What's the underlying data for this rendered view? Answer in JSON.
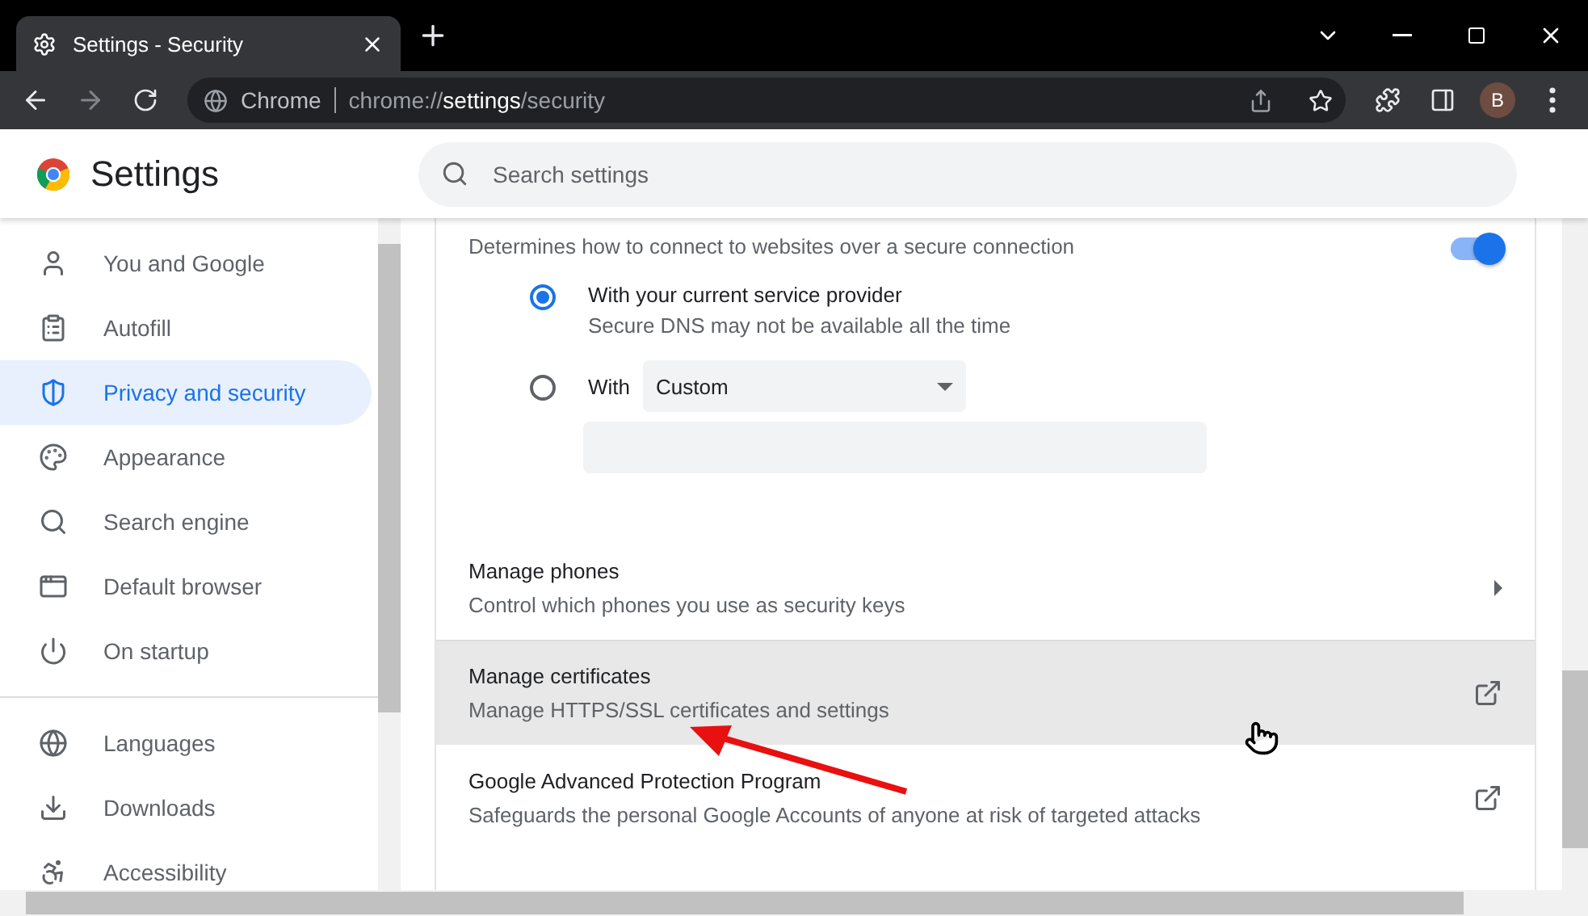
{
  "tab": {
    "title": "Settings - Security"
  },
  "address_bar": {
    "site_label": "Chrome",
    "url": "chrome://**settings**/security"
  },
  "profile": {
    "initial": "B"
  },
  "header": {
    "title": "Settings",
    "search": {
      "placeholder": "Search settings"
    }
  },
  "sidebar": {
    "groups": [
      [
        {
          "label": "You and Google",
          "selected": false
        },
        {
          "label": "Autofill",
          "selected": false
        },
        {
          "label": "Privacy and security",
          "selected": true
        },
        {
          "label": "Appearance",
          "selected": false
        },
        {
          "label": "Search engine",
          "selected": false
        },
        {
          "label": "Default browser",
          "selected": false
        },
        {
          "label": "On startup",
          "selected": false
        }
      ],
      [
        {
          "label": "Languages",
          "selected": false
        },
        {
          "label": "Downloads",
          "selected": false
        },
        {
          "label": "Accessibility",
          "selected": false
        }
      ]
    ]
  },
  "secure_dns": {
    "description": "Determines how to connect to websites over a secure connection",
    "on": true,
    "options": [
      {
        "kind": "plain",
        "label": "With your current service provider",
        "sublabel": "Secure DNS may not be available all the time",
        "selected": true
      },
      {
        "kind": "provider",
        "label": "With",
        "dropdown": "Custom",
        "selected": false
      }
    ]
  },
  "rows": [
    {
      "kind": "submenu",
      "title": "Manage phones",
      "description": "Control which phones you use as security keys",
      "hovered": false
    },
    {
      "kind": "external",
      "title": "Manage certificates",
      "description": "Manage HTTPS/SSL certificates and settings",
      "hovered": true
    },
    {
      "kind": "external",
      "title": "Google Advanced Protection Program",
      "description": "Safeguards the personal Google Accounts of anyone at risk of targeted attacks",
      "hovered": false
    }
  ]
}
